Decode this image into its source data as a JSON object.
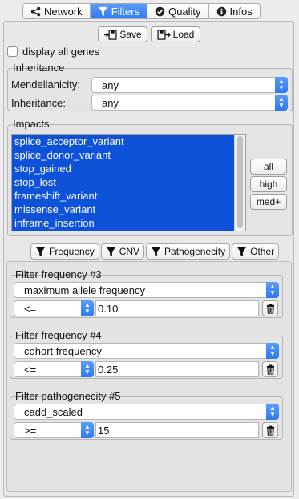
{
  "top_tabs": [
    {
      "label": "Network",
      "icon": "share-icon",
      "active": false
    },
    {
      "label": "Filters",
      "icon": "filter-icon",
      "active": true
    },
    {
      "label": "Quality",
      "icon": "check-circle-icon",
      "active": false
    },
    {
      "label": "Infos",
      "icon": "info-icon",
      "active": false
    }
  ],
  "toolbar": {
    "save_label": "Save",
    "load_label": "Load"
  },
  "display_all_genes": {
    "label": "display all genes",
    "checked": false
  },
  "inheritance": {
    "title": "Inheritance",
    "mendelianicity_label": "Mendelianicity:",
    "mendelianicity_value": "any",
    "inheritance_label": "Inheritance:",
    "inheritance_value": "any"
  },
  "impacts": {
    "title": "Impacts",
    "items": [
      "splice_acceptor_variant",
      "splice_donor_variant",
      "stop_gained",
      "stop_lost",
      "frameshift_variant",
      "missense_variant",
      "inframe_insertion"
    ],
    "buttons": {
      "all": "all",
      "high": "high",
      "med": "med+"
    }
  },
  "filter_tabs": [
    {
      "label": "Frequency"
    },
    {
      "label": "CNV"
    },
    {
      "label": "Pathogenecity"
    },
    {
      "label": "Other"
    }
  ],
  "filters": [
    {
      "title": "Filter frequency #3",
      "field": "maximum allele frequency",
      "operator": "<=",
      "value": "0.10"
    },
    {
      "title": "Filter frequency #4",
      "field": "cohort frequency",
      "operator": "<=",
      "value": "0.25"
    },
    {
      "title": "Filter pathogenecity #5",
      "field": "cadd_scaled",
      "operator": ">=",
      "value": "15"
    }
  ],
  "colors": {
    "accent": "#2f7cf6",
    "selection": "#0d52d9"
  }
}
